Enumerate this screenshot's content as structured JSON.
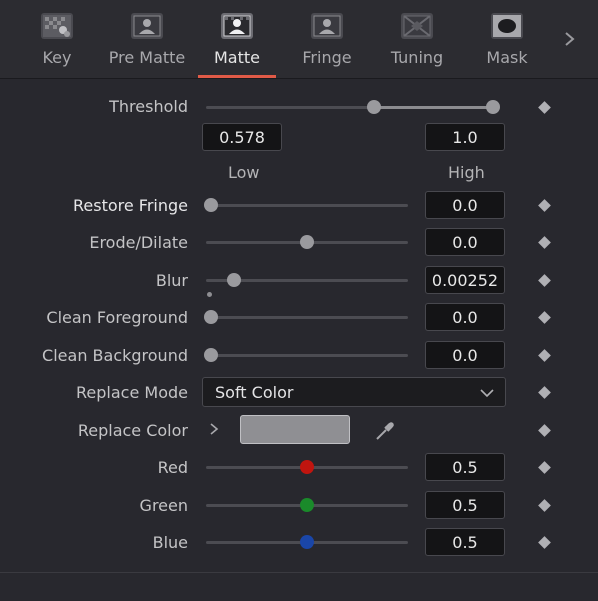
{
  "tabs": [
    {
      "label": "Key",
      "icon": "key-icon",
      "active": false
    },
    {
      "label": "Pre Matte",
      "icon": "pre-matte-icon",
      "active": false
    },
    {
      "label": "Matte",
      "icon": "matte-icon",
      "active": true
    },
    {
      "label": "Fringe",
      "icon": "fringe-icon",
      "active": false
    },
    {
      "label": "Tuning",
      "icon": "tuning-icon",
      "active": false
    },
    {
      "label": "Mask",
      "icon": "mask-icon",
      "active": false
    }
  ],
  "colors": {
    "accent": "#e05a47",
    "red": "#c0150f",
    "green": "#1a8a2a",
    "blue": "#1a46a8",
    "swatch": "#8f8f93"
  },
  "threshold": {
    "label": "Threshold",
    "low_value": "0.578",
    "high_value": "1.0",
    "low_label": "Low",
    "high_label": "High",
    "low_fraction": 0.578,
    "high_fraction": 1.0
  },
  "params": {
    "restore_fringe": {
      "label": "Restore Fringe",
      "value": "0.0",
      "fraction": 0.0
    },
    "erode_dilate": {
      "label": "Erode/Dilate",
      "value": "0.0",
      "fraction": 0.5
    },
    "blur": {
      "label": "Blur",
      "value": "0.00252",
      "fraction": 0.12
    },
    "clean_foreground": {
      "label": "Clean Foreground",
      "value": "0.0",
      "fraction": 0.0
    },
    "clean_background": {
      "label": "Clean Background",
      "value": "0.0",
      "fraction": 0.0
    },
    "replace_mode": {
      "label": "Replace Mode",
      "value": "Soft Color"
    },
    "replace_color": {
      "label": "Replace Color"
    },
    "red": {
      "label": "Red",
      "value": "0.5",
      "fraction": 0.5
    },
    "green": {
      "label": "Green",
      "value": "0.5",
      "fraction": 0.5
    },
    "blue": {
      "label": "Blue",
      "value": "0.5",
      "fraction": 0.5
    }
  }
}
